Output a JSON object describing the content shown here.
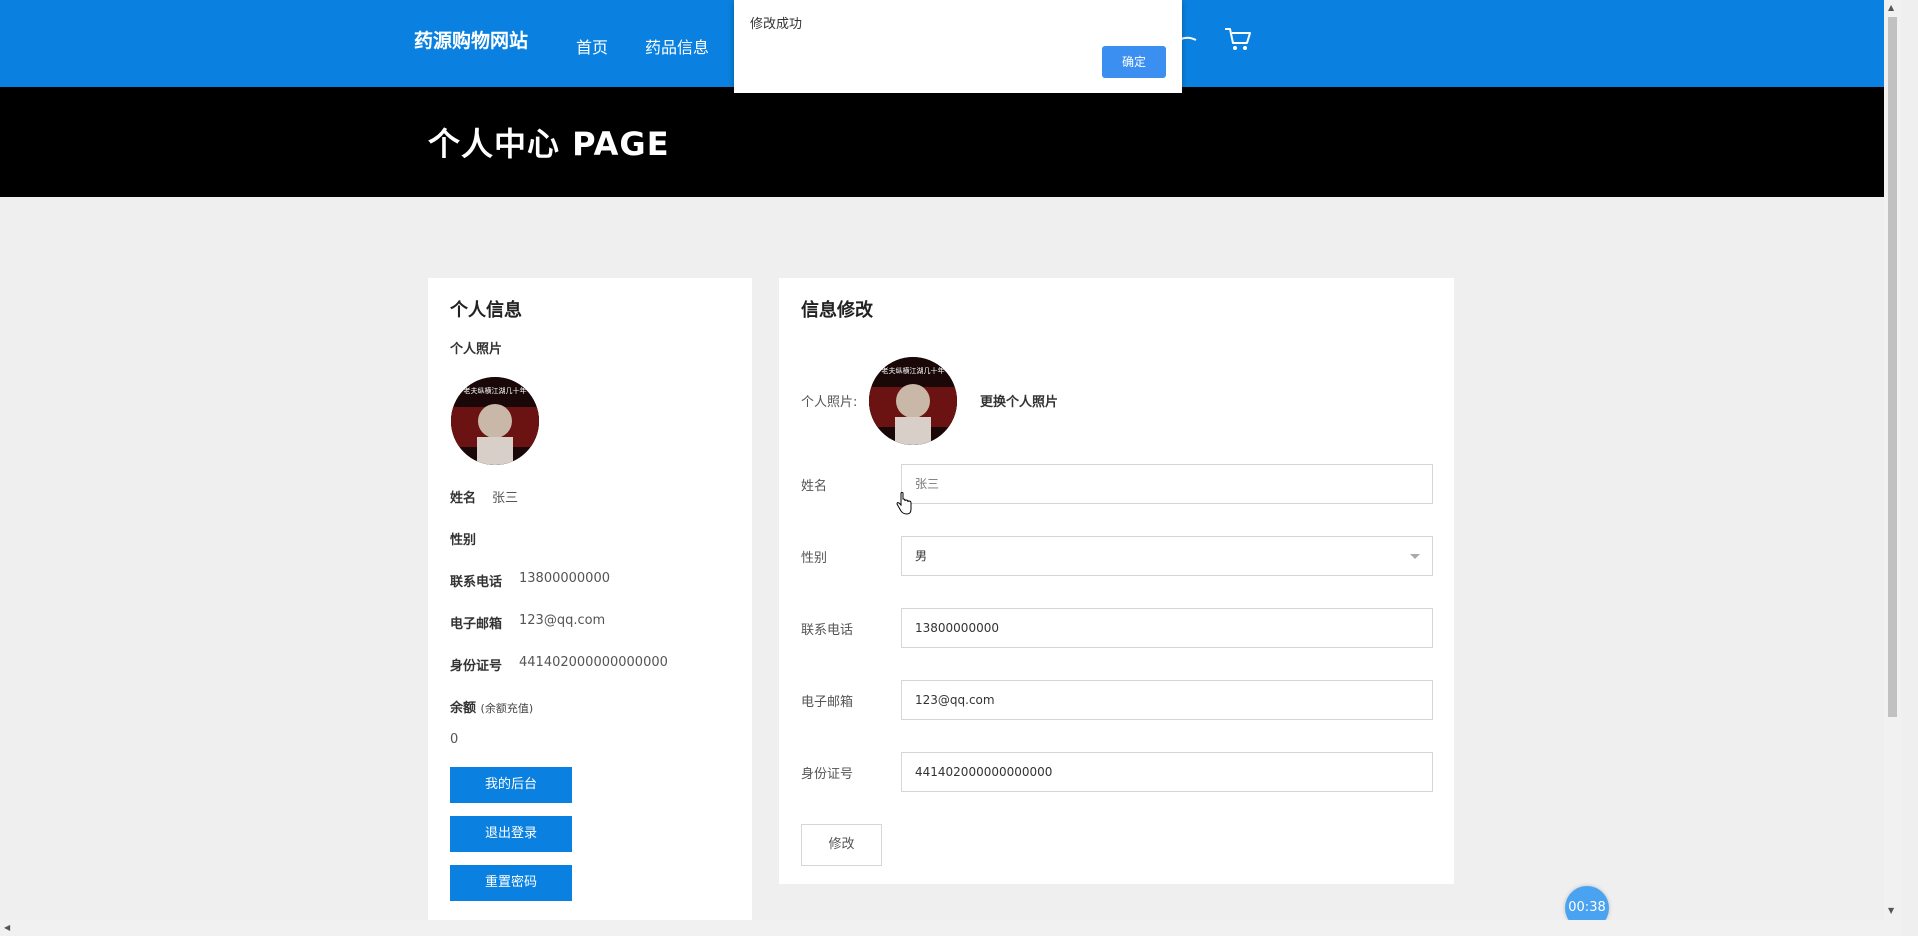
{
  "header": {
    "brand": "药源购物网站",
    "nav": [
      "首页",
      "药品信息"
    ],
    "icons": [
      "user-icon",
      "cart-icon"
    ],
    "accent_color": "#0a81e0"
  },
  "banner": {
    "title": "个人中心 PAGE"
  },
  "profile": {
    "title": "个人信息",
    "photo_label": "个人照片",
    "avatar_text": "老夫纵横江湖几十年",
    "fields": [
      {
        "label": "姓名",
        "value": "张三"
      },
      {
        "label": "性别",
        "value": ""
      },
      {
        "label": "联系电话",
        "value": "13800000000"
      },
      {
        "label": "电子邮箱",
        "value": "123@qq.com"
      },
      {
        "label": "身份证号",
        "value": "441402000000000000"
      }
    ],
    "balance_label": "余额",
    "balance_hint": "(余额充值)",
    "balance_value": "0",
    "buttons": [
      "我的后台",
      "退出登录",
      "重置密码"
    ]
  },
  "edit": {
    "title": "信息修改",
    "photo_label": "个人照片:",
    "change_photo": "更换个人照片",
    "fields": [
      {
        "label": "姓名",
        "value": "张三"
      },
      {
        "label": "性别",
        "value": "男"
      },
      {
        "label": "联系电话",
        "value": "13800000000"
      },
      {
        "label": "电子邮箱",
        "value": "123@qq.com"
      },
      {
        "label": "身份证号",
        "value": "441402000000000000"
      }
    ],
    "submit": "修改"
  },
  "dialog": {
    "message": "修改成功",
    "ok": "确定"
  },
  "timer": "00:38"
}
